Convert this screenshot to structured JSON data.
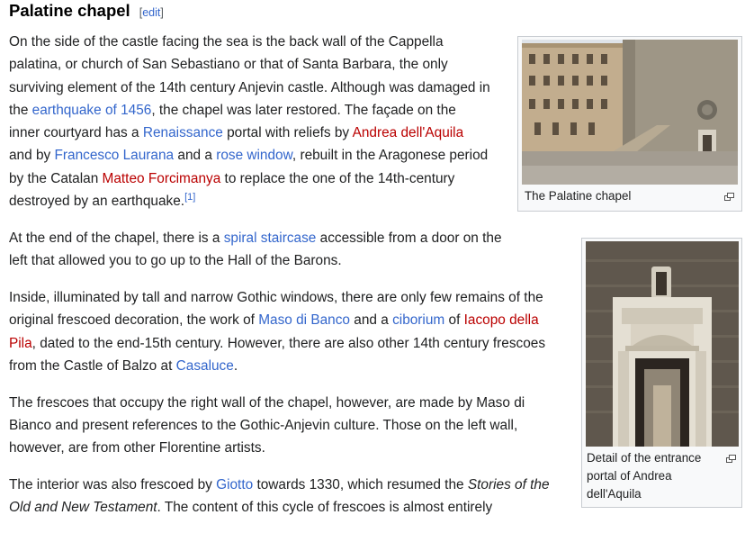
{
  "section": {
    "title": "Palatine chapel",
    "edit_open": "[",
    "edit_label": "edit",
    "edit_close": "]"
  },
  "p1": {
    "t1": "On the side of the castle facing the sea is the back wall of the Cappella palatina, or church of San Sebastiano or that of Santa Barbara, the only surviving element of the 14th century Anjevin castle. Although was damaged in the ",
    "l1": "earthquake of 1456",
    "t2": ", the chapel was later restored. The façade on the inner courtyard has a ",
    "l2": "Renaissance",
    "t3": " portal with reliefs by ",
    "l3": "Andrea dell'Aquila",
    "t4": " and by ",
    "l4": "Francesco Laurana",
    "t5": " and a ",
    "l5": "rose window",
    "t6": ", rebuilt in the Aragonese period by the Catalan ",
    "l6": "Matteo Forcimanya",
    "t7": " to replace the one of the 14th-century destroyed by an earthquake.",
    "ref": "[1]"
  },
  "p2": {
    "t1": "At the end of the chapel, there is a ",
    "l1": "spiral staircase",
    "t2": " accessible from a door on the left that allowed you to go up to the Hall of the Barons."
  },
  "p3": {
    "t1": "Inside, illuminated by tall and narrow Gothic windows, there are only few remains of the original frescoed decoration, the work of ",
    "l1": "Maso di Banco",
    "t2": " and a ",
    "l2": "ciborium",
    "t3": " of ",
    "l3": "Iacopo della Pila",
    "t4": ", dated to the end-15th century. However, there are also other 14th century frescoes from the Castle of Balzo at ",
    "l4": "Casaluce",
    "t5": "."
  },
  "p4": {
    "t1": "The frescoes that occupy the right wall of the chapel, however, are made by Maso di Bianco and present references to the Gothic-Anjevin culture. Those on the left wall, however, are from other Florentine artists."
  },
  "p5": {
    "t1": "The interior was also frescoed by ",
    "l1": "Giotto",
    "t2": " towards 1330, which resumed the ",
    "em": "Stories of the Old and New Testament",
    "t3": ". The content of this cycle of frescoes is almost entirely"
  },
  "figure1": {
    "caption": "The Palatine chapel"
  },
  "figure2": {
    "caption": "Detail of the entrance portal of Andrea dell'Aquila"
  },
  "icons": {
    "enlarge": "magnify-clip-icon"
  }
}
